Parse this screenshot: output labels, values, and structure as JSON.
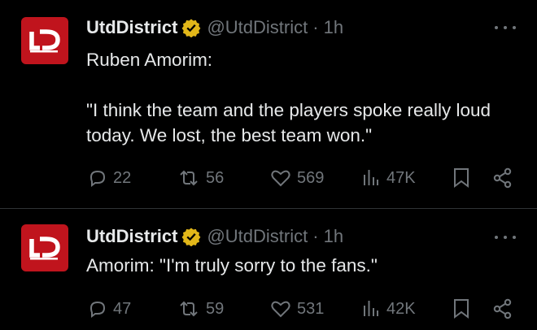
{
  "tweets": [
    {
      "display_name": "UtdDistrict",
      "handle": "@UtdDistrict",
      "separator": "·",
      "time": "1h",
      "text": "Ruben Amorim:\n\n\"I think the team and the players spoke really loud today. We lost, the best team won.\"",
      "stats": {
        "replies": "22",
        "reposts": "56",
        "likes": "569",
        "views": "47K"
      }
    },
    {
      "display_name": "UtdDistrict",
      "handle": "@UtdDistrict",
      "separator": "·",
      "time": "1h",
      "text": "Amorim: \"I'm truly sorry to the fans.\"",
      "stats": {
        "replies": "47",
        "reposts": "59",
        "likes": "531",
        "views": "42K"
      }
    }
  ],
  "icons": {
    "avatar": "utd-district-logo",
    "verified": "verified-badge-icon",
    "more": "more-options-icon",
    "reply": "reply-icon",
    "repost": "repost-icon",
    "like": "heart-icon",
    "views": "views-icon",
    "bookmark": "bookmark-icon",
    "share": "share-icon"
  },
  "colors": {
    "background": "#000000",
    "text": "#e7e9ea",
    "muted": "#71767b",
    "divider": "#2f3336",
    "avatar_bg": "#c0141d",
    "verified": "#e2b719"
  }
}
